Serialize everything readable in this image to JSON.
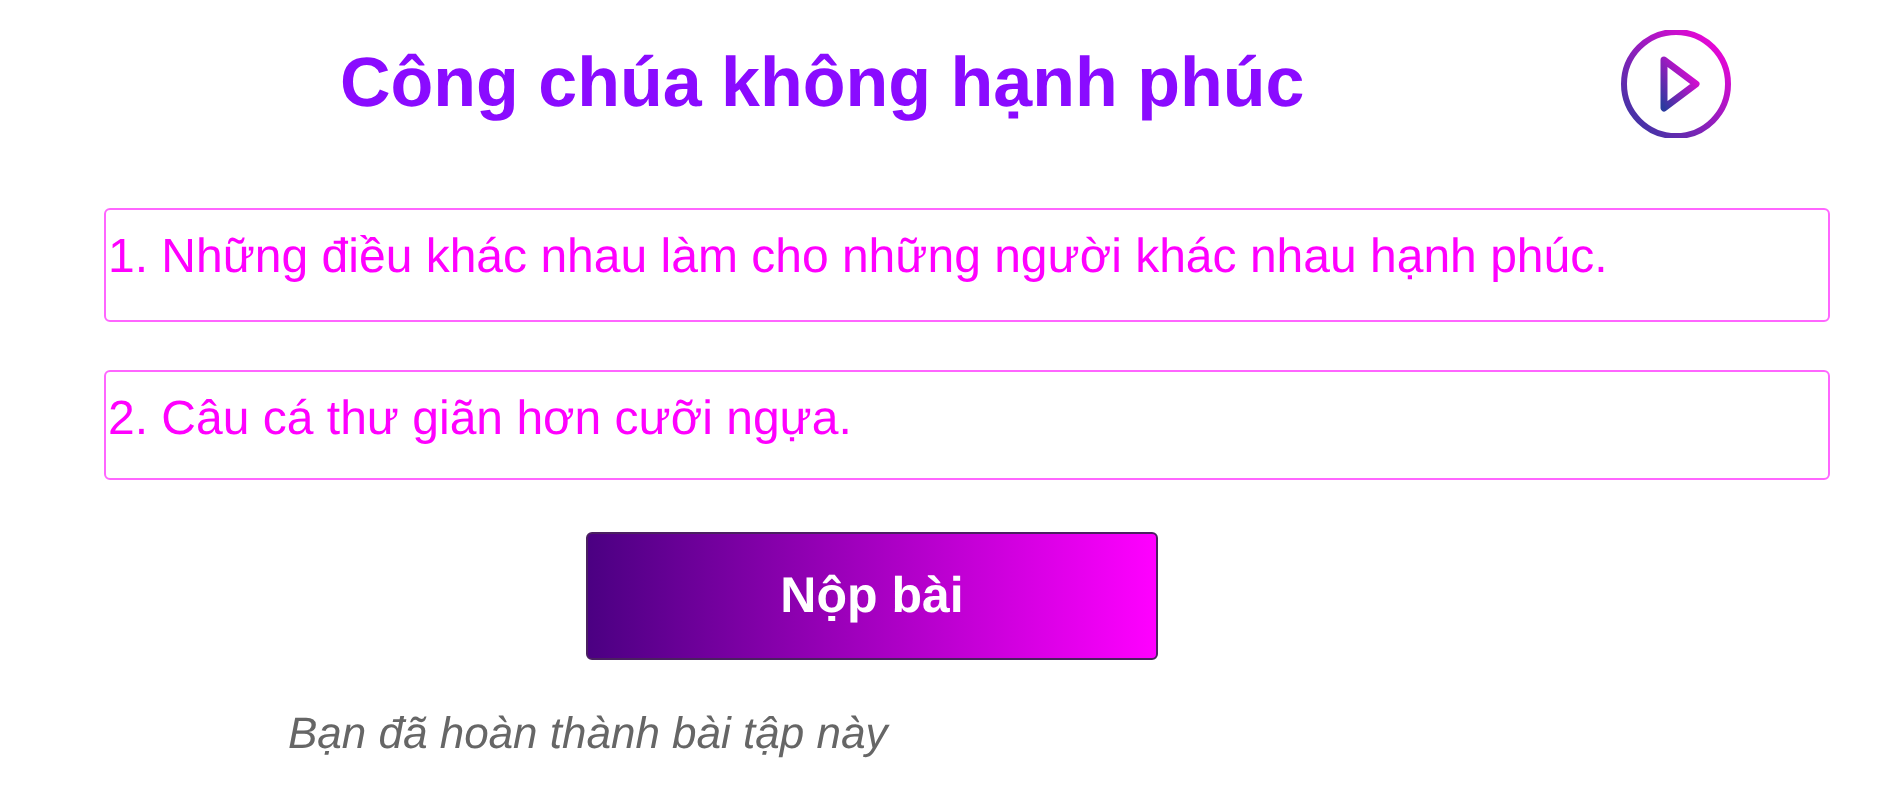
{
  "title": "Công chúa không hạnh phúc",
  "sentences": [
    "1. Những điều khác nhau làm cho những người khác nhau hạnh phúc.",
    "2. Câu cá thư giãn hơn cưỡi ngựa."
  ],
  "submit_button": "Nộp bài",
  "status": "Bạn đã hoàn thành bài tập này"
}
